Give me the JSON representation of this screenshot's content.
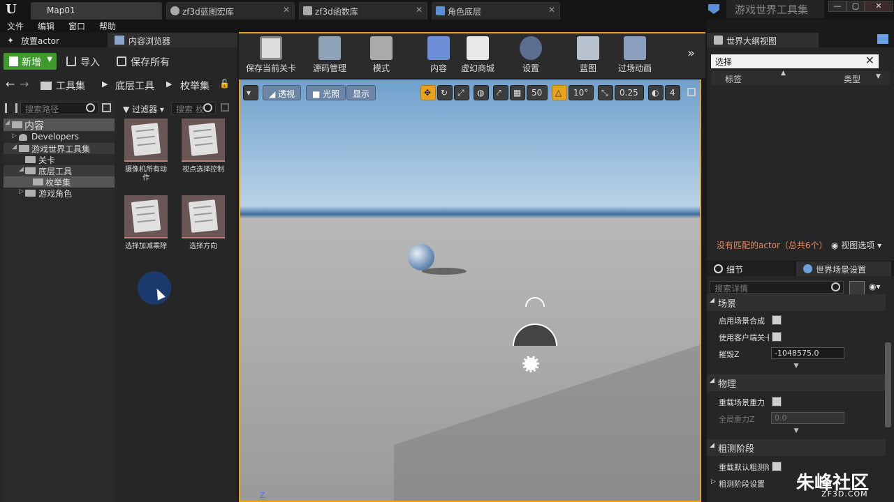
{
  "titlebar": {
    "tabs": [
      "Map01",
      "zf3d蓝图宏库",
      "zf3d函数库",
      "角色底层"
    ],
    "app_title": "游戏世界工具集",
    "window_buttons": [
      "—",
      "▢",
      "✕"
    ]
  },
  "menu": [
    "文件",
    "编辑",
    "窗口",
    "帮助"
  ],
  "left_panel": {
    "tabs": [
      "放置actor",
      "内容浏览器"
    ],
    "new_button": "新增",
    "import_button": "导入",
    "save_all_button": "保存所有",
    "breadcrumbs": [
      "工具集",
      "底层工具",
      "枚举集"
    ],
    "search_path_placeholder": "搜索路径",
    "filter_label": "过滤器",
    "search_assets_placeholder": "搜索 枚",
    "tree": [
      {
        "label": "内容",
        "level": 0
      },
      {
        "label": "Developers",
        "level": 1
      },
      {
        "label": "游戏世界工具集",
        "level": 1
      },
      {
        "label": "关卡",
        "level": 2
      },
      {
        "label": "底层工具",
        "level": 2
      },
      {
        "label": "枚举集",
        "level": 3
      },
      {
        "label": "游戏角色",
        "level": 1
      }
    ],
    "assets": [
      {
        "name": "摄像机所有动作"
      },
      {
        "name": "视点选择控制"
      },
      {
        "name": "选择加减乘除"
      },
      {
        "name": "选择方向"
      }
    ]
  },
  "toolbar": {
    "tools": [
      {
        "label": "保存当前关卡",
        "icon": "save-icon"
      },
      {
        "label": "源码管理",
        "icon": "source-control-icon"
      },
      {
        "label": "模式",
        "icon": "modes-icon"
      },
      {
        "label": "内容",
        "icon": "content-icon"
      },
      {
        "label": "虚幻商城",
        "icon": "marketplace-icon"
      },
      {
        "label": "设置",
        "icon": "settings-icon"
      },
      {
        "label": "蓝图",
        "icon": "blueprint-icon"
      },
      {
        "label": "过场动画",
        "icon": "cinematics-icon"
      }
    ],
    "more": "»"
  },
  "viewport": {
    "perspective": "透视",
    "lit": "光照",
    "show": "显示",
    "grid_snap": "50",
    "rot_snap": "10°",
    "scale_snap": "0.25",
    "camera_speed": "4",
    "axis_label": "Z"
  },
  "outliner": {
    "tab": "世界大纲视图",
    "search_value": "选择",
    "col_label": "标签",
    "col_type": "类型",
    "status": "没有匹配的actor（总共6个）",
    "view_options": "视图选项"
  },
  "details": {
    "tabs": [
      "细节",
      "世界场景设置"
    ],
    "search_placeholder": "搜索详情",
    "sections": [
      {
        "title": "场景",
        "props": [
          {
            "label": "启用场景合成",
            "type": "check"
          },
          {
            "label": "使用客户端关卡",
            "type": "check"
          },
          {
            "label": "摧毁Z",
            "type": "num",
            "value": "-1048575.0"
          }
        ]
      },
      {
        "title": "物理",
        "props": [
          {
            "label": "重载场景重力",
            "type": "check"
          },
          {
            "label": "全局重力Z",
            "type": "num",
            "value": "0.0",
            "disabled": true
          }
        ]
      },
      {
        "title": "粗测阶段",
        "props": [
          {
            "label": "重载默认粗测阶段",
            "type": "check"
          },
          {
            "label": "粗测阶段设置",
            "type": "sub"
          }
        ]
      }
    ]
  },
  "watermark": {
    "main": "朱峰社区",
    "sub": "ZF3D.COM"
  }
}
